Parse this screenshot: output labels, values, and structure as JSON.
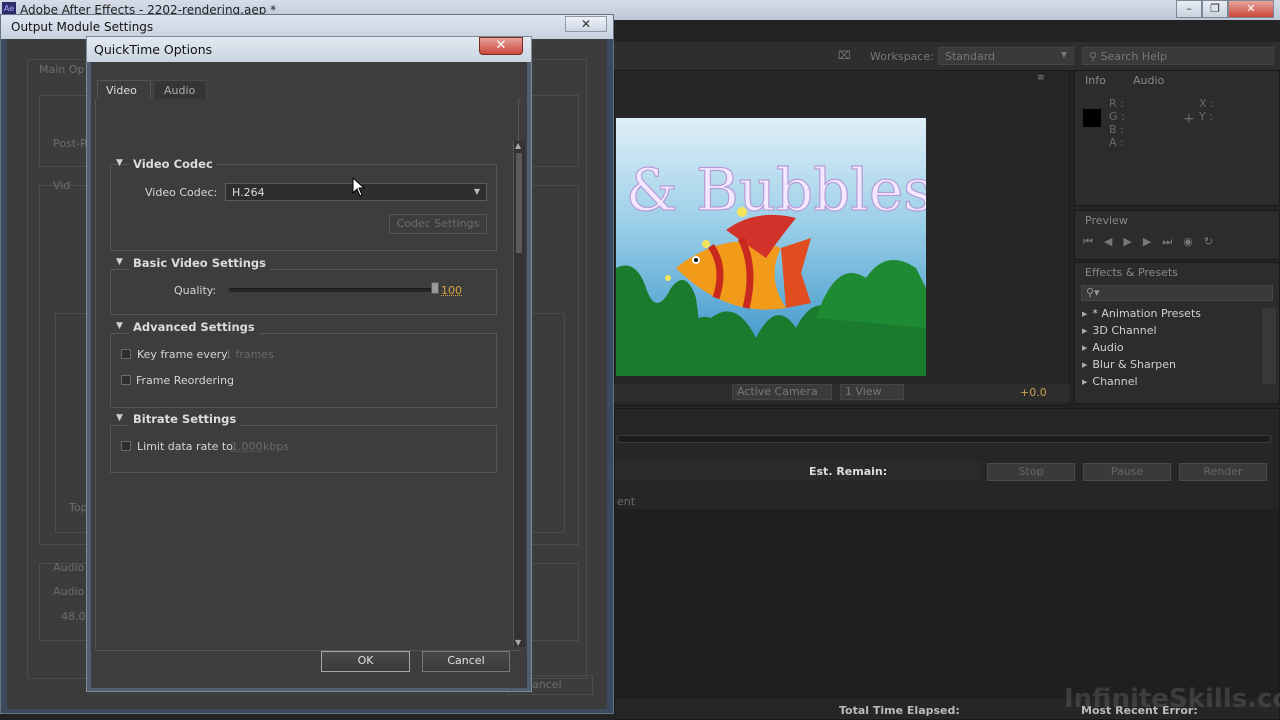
{
  "ae": {
    "title": "Adobe After Effects - 2202-rendering.aep *",
    "workspace_label": "Workspace:",
    "workspace_value": "Standard",
    "search_placeholder": "Search Help",
    "info_tab": "Info",
    "audio_tab": "Audio",
    "info_r": "R :",
    "info_g": "G :",
    "info_b": "B :",
    "info_a": "A :",
    "info_x": "X :",
    "info_y": "Y :",
    "preview_tab": "Preview",
    "effects_tab": "Effects & Presets",
    "effects_items": [
      "* Animation Presets",
      "3D Channel",
      "Audio",
      "Blur & Sharpen",
      "Channel"
    ],
    "comp_text": "& Bubbles",
    "viewer_camera": "Active Camera",
    "viewer_views": "1 View",
    "viewer_exposure": "+0.0",
    "render_est_remain": "Est. Remain:",
    "render_stop": "Stop",
    "render_pause": "Pause",
    "render_render": "Render",
    "render_col_partial": "ent",
    "total_time_elapsed": "Total Time Elapsed:",
    "most_recent_error": "Most Recent Error:",
    "watermark": "InfiniteSkills.com"
  },
  "om": {
    "title": "Output Module Settings",
    "main_options_tab": "Main Op",
    "post_render_partial": "Post-R",
    "video_partial": "Vid",
    "audio_partial": "Audio",
    "audio_output_partial": "Audio",
    "sample_rate_partial": "48.0",
    "top_partial": "Top",
    "cancel_partial": "ancel"
  },
  "qt": {
    "title": "QuickTime Options",
    "tabs": [
      "Video",
      "Audio"
    ],
    "video_codec_section": "Video Codec",
    "video_codec_label": "Video Codec:",
    "video_codec_value": "H.264",
    "codec_settings_button": "Codec Settings",
    "basic_video_section": "Basic Video Settings",
    "quality_label": "Quality:",
    "quality_value": "100",
    "quality_fraction": 1.0,
    "advanced_section": "Advanced Settings",
    "keyframe_label": "Key frame every",
    "keyframe_value": "1 frames",
    "frame_reordering_label": "Frame Reordering",
    "bitrate_section": "Bitrate Settings",
    "limit_label": "Limit data rate to",
    "limit_value": "1,000",
    "limit_unit": "kbps",
    "ok_label": "OK",
    "cancel_label": "Cancel"
  }
}
